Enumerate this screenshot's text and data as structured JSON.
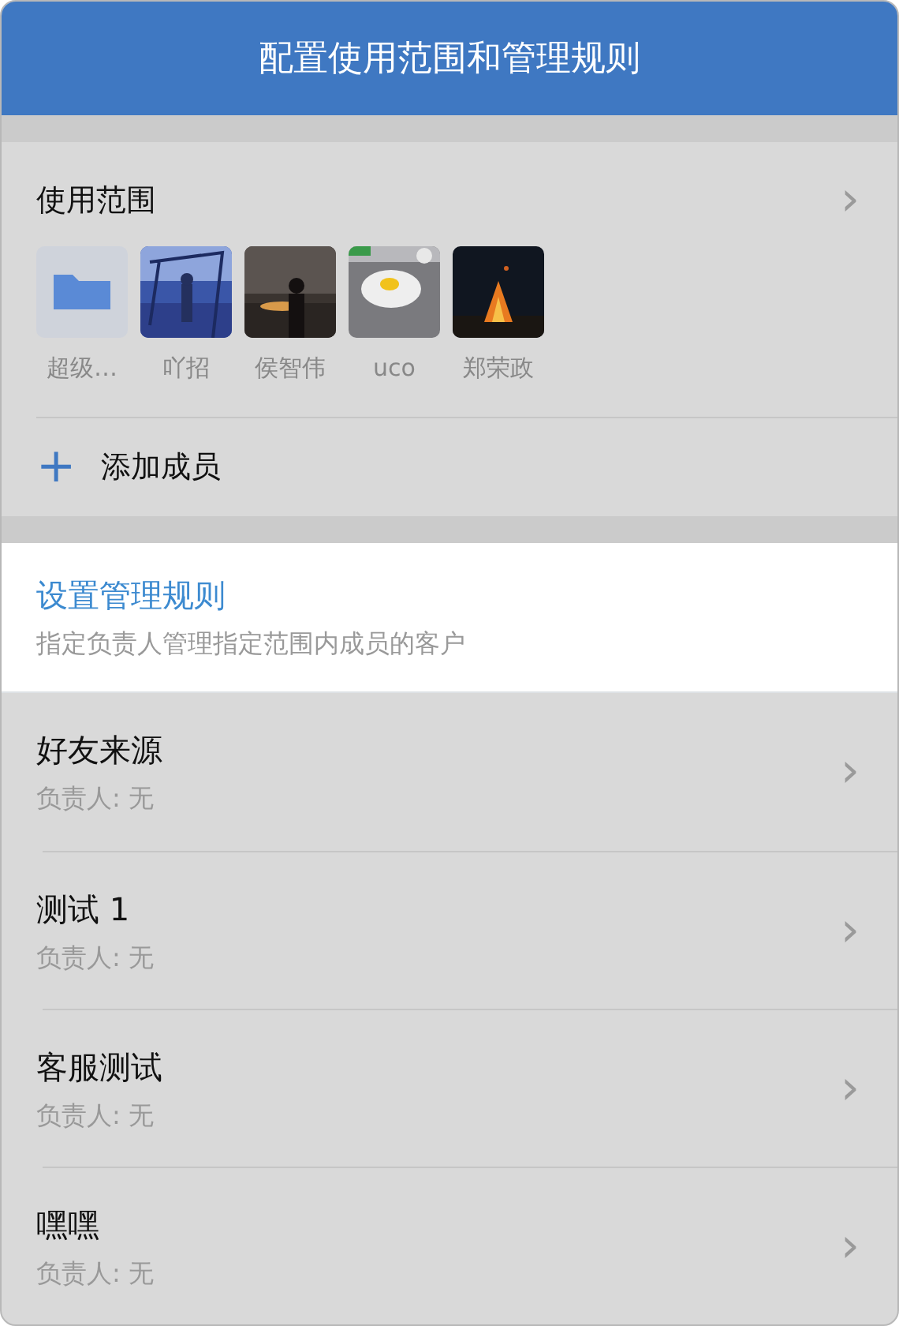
{
  "header": {
    "title": "配置使用范围和管理规则"
  },
  "scope": {
    "title": "使用范围",
    "chevron": "›",
    "members": [
      {
        "name": "超级…",
        "kind": "folder"
      },
      {
        "name": "吖招",
        "kind": "picture"
      },
      {
        "name": "侯智伟",
        "kind": "picture"
      },
      {
        "name": "uco",
        "kind": "picture"
      },
      {
        "name": "郑荣政",
        "kind": "picture"
      }
    ],
    "add": {
      "icon": "+",
      "label": "添加成员"
    }
  },
  "rule_header": {
    "title": "设置管理规则",
    "subtitle": "指定负责人管理指定范围内成员的客户"
  },
  "rules": [
    {
      "name": "好友来源",
      "owner": "负责人: 无",
      "chevron": "›"
    },
    {
      "name": "测试 1",
      "owner": "负责人: 无",
      "chevron": "›"
    },
    {
      "name": "客服测试",
      "owner": "负责人: 无",
      "chevron": "›"
    },
    {
      "name": "嘿嘿",
      "owner": "负责人: 无",
      "chevron": "›"
    }
  ]
}
